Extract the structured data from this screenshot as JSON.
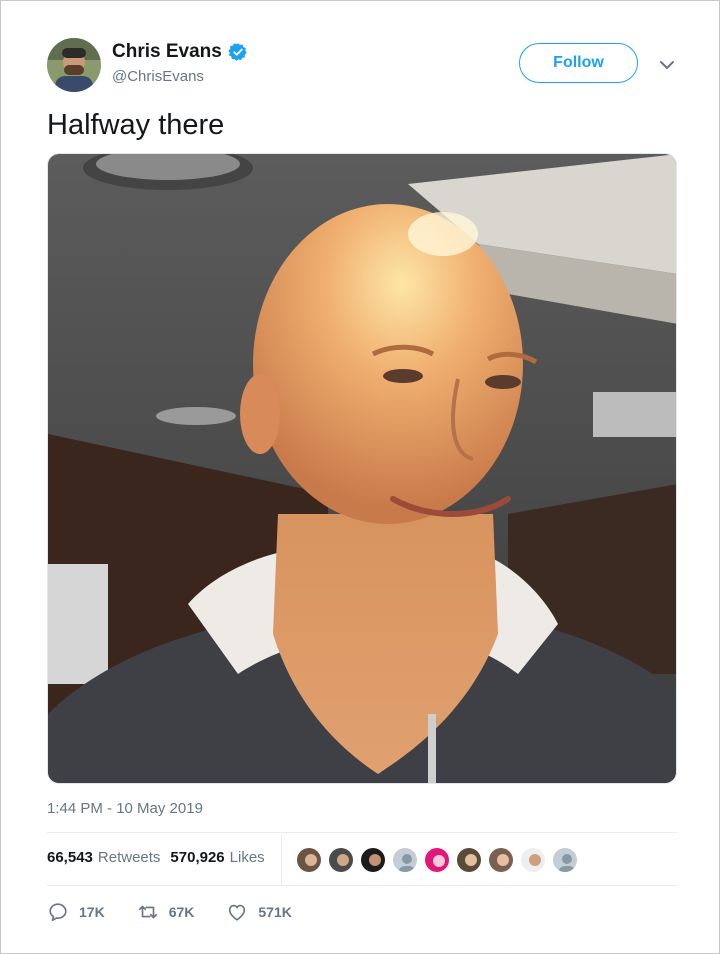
{
  "author": {
    "display_name": "Chris Evans",
    "handle": "@ChrisEvans",
    "verified": true
  },
  "follow_label": "Follow",
  "tweet": {
    "text": "Halfway there",
    "timestamp": "1:44 PM - 10 May 2019"
  },
  "stats": {
    "retweets_count": "66,543",
    "retweets_label": "Retweets",
    "likes_count": "570,926",
    "likes_label": "Likes"
  },
  "actions": {
    "replies": "17K",
    "retweets": "67K",
    "likes": "571K"
  },
  "colors": {
    "accent": "#1da1f2",
    "muted": "#657786",
    "text": "#14171a"
  },
  "icons": [
    "verified-badge-icon",
    "chevron-down-icon",
    "reply-icon",
    "retweet-icon",
    "like-icon"
  ]
}
